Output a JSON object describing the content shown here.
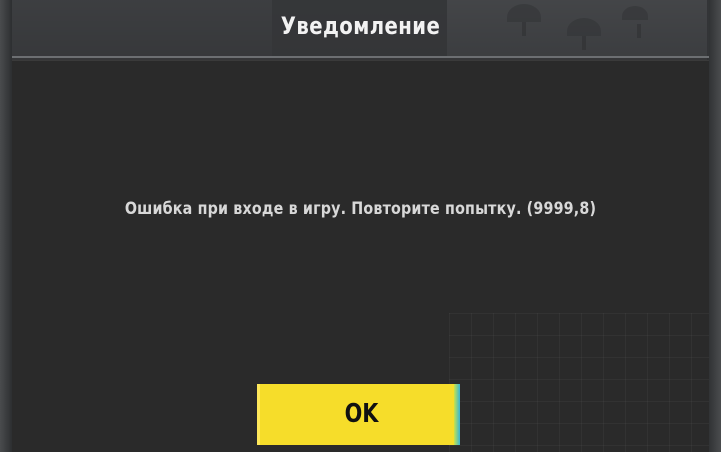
{
  "dialog": {
    "title": "Уведомление",
    "message": "Ошибка при входе в игру. Повторите попытку. (9999,8)",
    "ok_label": "OK"
  },
  "colors": {
    "button_bg": "#f6dd2a",
    "body_bg": "#2a2a2a",
    "title_text": "#f2f2f2",
    "message_text": "#d8d8d8"
  }
}
